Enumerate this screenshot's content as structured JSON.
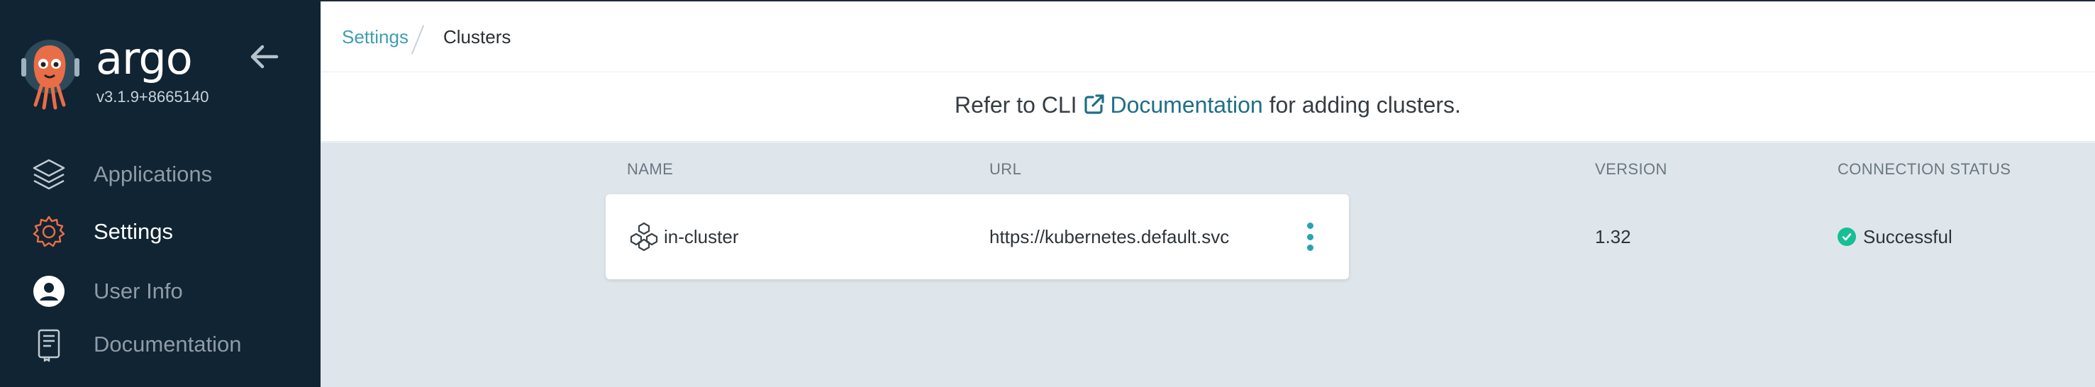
{
  "sidebar": {
    "brand": "argo",
    "version": "v3.1.9+8665140",
    "items": [
      {
        "label": "Applications",
        "icon": "layers-icon",
        "active": false
      },
      {
        "label": "Settings",
        "icon": "gear-icon",
        "active": true
      },
      {
        "label": "User Info",
        "icon": "user-icon",
        "active": false
      },
      {
        "label": "Documentation",
        "icon": "book-icon",
        "active": false
      }
    ]
  },
  "breadcrumb": {
    "settings": "Settings",
    "current": "Clusters"
  },
  "info": {
    "prefix": "Refer to CLI",
    "link": "Documentation",
    "suffix": "for adding clusters."
  },
  "table": {
    "headers": [
      "NAME",
      "URL",
      "VERSION",
      "CONNECTION STATUS"
    ],
    "rows": [
      {
        "name": "in-cluster",
        "url": "https://kubernetes.default.svc",
        "version": "1.32",
        "status": "Successful"
      }
    ]
  },
  "colors": {
    "sidebar": "#102433",
    "accent": "#3f9db4",
    "link": "#1f6f86",
    "success": "#18be94",
    "page_bg": "#dee6eb",
    "logo_orange": "#e96d47"
  }
}
